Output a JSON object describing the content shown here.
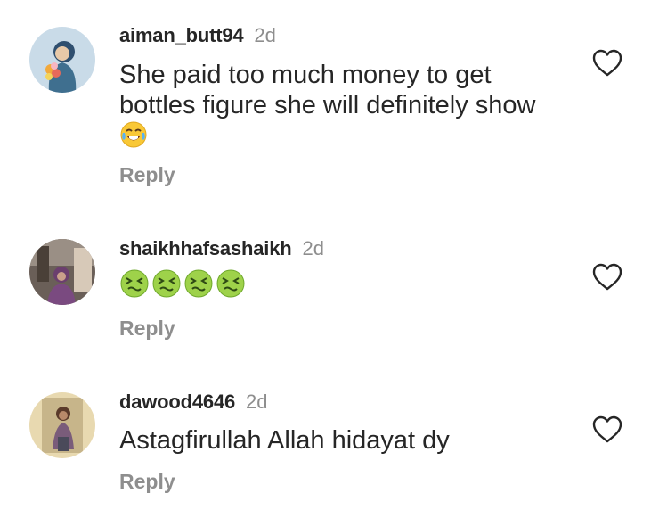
{
  "comments": [
    {
      "username": "aiman_butt94",
      "time": "2d",
      "text": "She paid too much money to get bottles figure she will definitely show",
      "emoji_names": [
        "face-with-tears-of-joy-emoji"
      ],
      "reply_label": "Reply"
    },
    {
      "username": "shaikhhafsashaikh",
      "time": "2d",
      "text": "",
      "emoji_names": [
        "nauseated-face-emoji",
        "nauseated-face-emoji",
        "nauseated-face-emoji",
        "nauseated-face-emoji"
      ],
      "reply_label": "Reply"
    },
    {
      "username": "dawood4646",
      "time": "2d",
      "text": "Astagfirullah Allah hidayat dy",
      "emoji_names": [],
      "reply_label": "Reply"
    }
  ],
  "icons": {
    "like": "heart-outline-icon"
  },
  "colors": {
    "text_primary": "#262626",
    "text_secondary": "#8e8e8e",
    "background": "#ffffff"
  }
}
